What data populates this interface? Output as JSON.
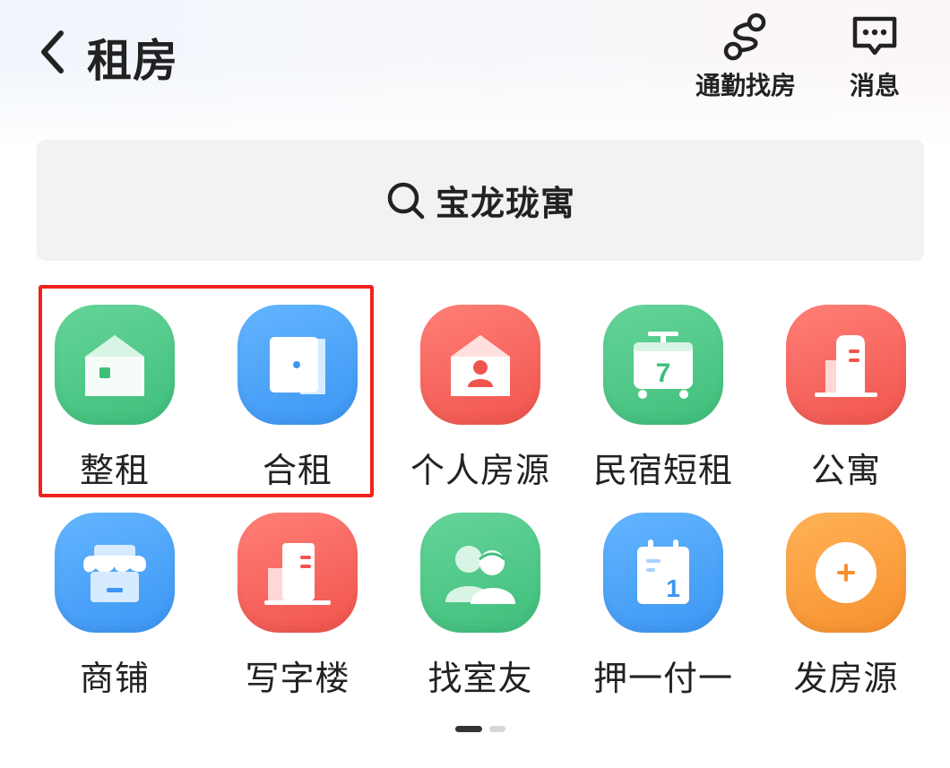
{
  "header": {
    "title": "租房",
    "actions": {
      "commute_label": "通勤找房",
      "messages_label": "消息"
    }
  },
  "search": {
    "text": "宝龙珑寓"
  },
  "categories": [
    {
      "label": "整租",
      "icon": "whole-rent-house-icon",
      "color": "#4cc986"
    },
    {
      "label": "合租",
      "icon": "shared-rent-door-icon",
      "color": "#4ba6fa"
    },
    {
      "label": "个人房源",
      "icon": "personal-listing-icon",
      "color": "#f86660"
    },
    {
      "label": "民宿短租",
      "icon": "homestay-calendar-7-icon",
      "color": "#4cc986"
    },
    {
      "label": "公寓",
      "icon": "apartment-building-icon",
      "color": "#f86660"
    },
    {
      "label": "商铺",
      "icon": "shop-storefront-icon",
      "color": "#4ba6fa"
    },
    {
      "label": "写字楼",
      "icon": "office-building-icon",
      "color": "#f86660"
    },
    {
      "label": "找室友",
      "icon": "find-roommate-icon",
      "color": "#4cc986"
    },
    {
      "label": "押一付一",
      "icon": "deposit-calendar-1-icon",
      "color": "#4ba6fa"
    },
    {
      "label": "发房源",
      "icon": "post-listing-plus-icon",
      "color": "#f7962f"
    }
  ],
  "highlight": {
    "color": "#f0231d",
    "covers": [
      "整租",
      "合租"
    ]
  },
  "pager": {
    "pages": 2,
    "current": 1
  }
}
